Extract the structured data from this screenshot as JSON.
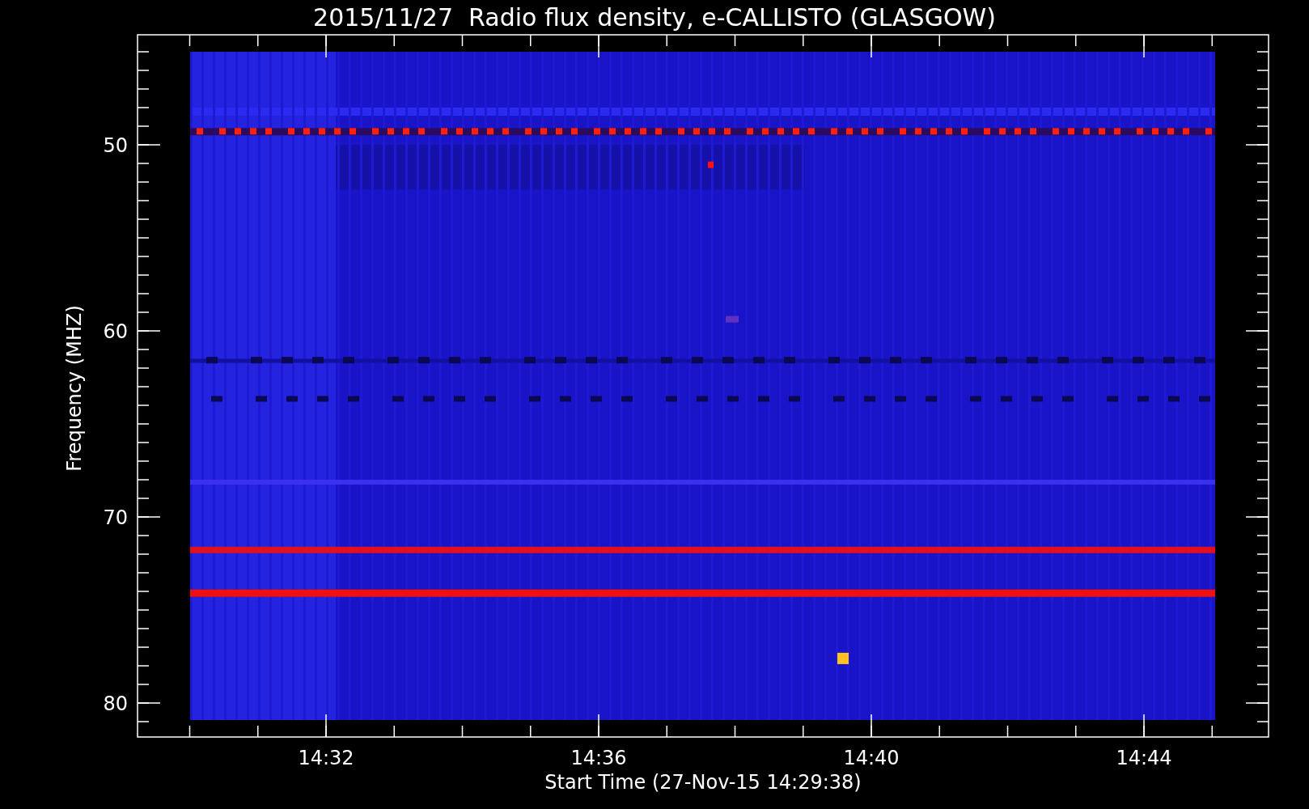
{
  "title": "2015/11/27  Radio flux density, e-CALLISTO (GLASGOW)",
  "y_axis": {
    "label": "Frequency (MHZ)",
    "ticks": [
      "50",
      "60",
      "70",
      "80"
    ]
  },
  "x_axis": {
    "label": "Start Time (27-Nov-15 14:29:38)",
    "ticks": [
      "14:32",
      "14:36",
      "14:40",
      "14:44"
    ]
  }
}
